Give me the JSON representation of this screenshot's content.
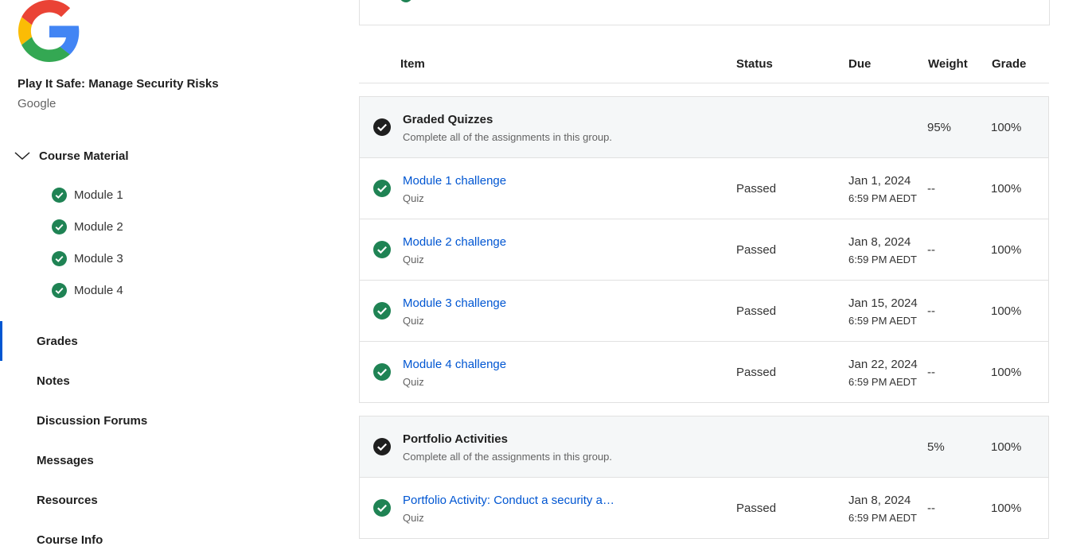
{
  "course": {
    "title": "Play It Safe: Manage Security Risks",
    "org": "Google",
    "logo_icon": "google-g-logo"
  },
  "sidebar": {
    "section_label": "Course Material",
    "section_icon": "chevron-down-icon",
    "modules": [
      {
        "label": "Module 1",
        "icon": "check-circle-icon"
      },
      {
        "label": "Module 2",
        "icon": "check-circle-icon"
      },
      {
        "label": "Module 3",
        "icon": "check-circle-icon"
      },
      {
        "label": "Module 4",
        "icon": "check-circle-icon"
      }
    ],
    "nav": [
      "Grades",
      "Notes",
      "Discussion Forums",
      "Messages",
      "Resources",
      "Course Info"
    ],
    "active_nav": "Grades"
  },
  "table": {
    "headers": {
      "item": "Item",
      "status": "Status",
      "due": "Due",
      "weight": "Weight",
      "grade": "Grade"
    },
    "groups": [
      {
        "title": "Graded Quizzes",
        "subtitle": "Complete all of the assignments in this group.",
        "weight": "95%",
        "grade": "100%",
        "items": [
          {
            "title": "Module 1 challenge",
            "type": "Quiz",
            "status": "Passed",
            "due_date": "Jan 1, 2024",
            "due_time": "6:59 PM AEDT",
            "weight": "--",
            "grade": "100%"
          },
          {
            "title": "Module 2 challenge",
            "type": "Quiz",
            "status": "Passed",
            "due_date": "Jan 8, 2024",
            "due_time": "6:59 PM AEDT",
            "weight": "--",
            "grade": "100%"
          },
          {
            "title": "Module 3 challenge",
            "type": "Quiz",
            "status": "Passed",
            "due_date": "Jan 15, 2024",
            "due_time": "6:59 PM AEDT",
            "weight": "--",
            "grade": "100%"
          },
          {
            "title": "Module 4 challenge",
            "type": "Quiz",
            "status": "Passed",
            "due_date": "Jan 22, 2024",
            "due_time": "6:59 PM AEDT",
            "weight": "--",
            "grade": "100%"
          }
        ]
      },
      {
        "title": "Portfolio Activities",
        "subtitle": "Complete all of the assignments in this group.",
        "weight": "5%",
        "grade": "100%",
        "items": [
          {
            "title": "Portfolio Activity: Conduct a security a…",
            "type": "Quiz",
            "status": "Passed",
            "due_date": "Jan 8, 2024",
            "due_time": "6:59 PM AEDT",
            "weight": "--",
            "grade": "100%"
          }
        ]
      }
    ]
  },
  "colors": {
    "accent": "#0056d2",
    "success": "#1f8354",
    "group_bg": "#f5f7f8",
    "border": "#e1e1e1"
  }
}
